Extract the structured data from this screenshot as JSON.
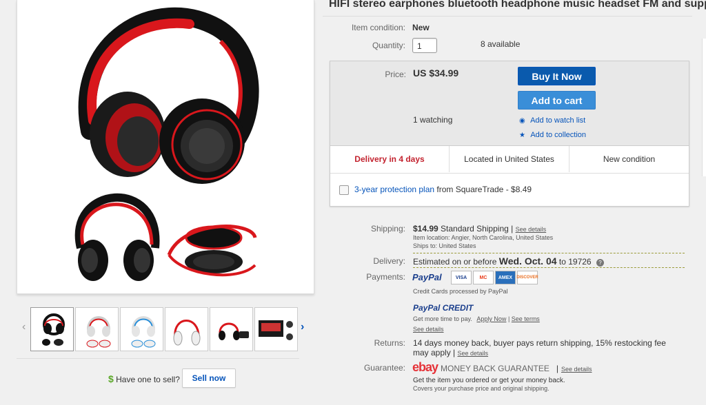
{
  "title": "HIFI stereo earphones bluetooth headphone music headset FM and support",
  "condition": {
    "label": "Item condition:",
    "value": "New"
  },
  "quantity": {
    "label": "Quantity:",
    "value": "1",
    "available": "8 available"
  },
  "price": {
    "label": "Price:",
    "value": "US $34.99"
  },
  "buttons": {
    "buy_now": "Buy It Now",
    "add_to_cart": "Add to cart"
  },
  "watching": "1 watching",
  "links": {
    "watch_list": "Add to watch list",
    "collection": "Add to collection"
  },
  "features": {
    "delivery": "Delivery in 4 days",
    "location": "Located in United States",
    "condition": "New condition"
  },
  "protection": {
    "link": "3-year protection plan",
    "rest": "from SquareTrade - $8.49"
  },
  "shipping": {
    "label": "Shipping:",
    "cost": "$14.99",
    "method": "Standard Shipping",
    "sep": "|",
    "see_details": "See details",
    "item_location": "Item location:  Angier, North Carolina, United States",
    "ships_to": "Ships to:  United States"
  },
  "delivery": {
    "label": "Delivery:",
    "prefix": "Estimated on or before",
    "date": "Wed. Oct. 04",
    "suffix": "to 19726",
    "help": "?"
  },
  "payments": {
    "label": "Payments:",
    "paypal": "PayPal",
    "cards": [
      "VISA",
      "MC",
      "AMEX",
      "DISCOVER"
    ],
    "processed": "Credit Cards processed by PayPal",
    "credit_logo": "PayPal CREDIT",
    "more_time": "Get more time to pay.",
    "apply_now": "Apply Now",
    "sep": "|",
    "see_terms": "See terms",
    "see_details": "See details"
  },
  "returns": {
    "label": "Returns:",
    "text": "14 days money back, buyer pays return shipping, 15% restocking fee may apply",
    "sep": "|",
    "see_details": "See details"
  },
  "guarantee": {
    "label": "Guarantee:",
    "ebay": "ebay",
    "mbg": "MONEY BACK GUARANTEE",
    "sep": "|",
    "see_details": "See details",
    "line1": "Get the item you ordered or get your money back.",
    "line2": "Covers your purchase price and original shipping."
  },
  "sell": {
    "question": "Have one to sell?",
    "button": "Sell now",
    "dollar": "$"
  },
  "gallery": {
    "prev": "‹",
    "next": "›"
  },
  "colors": {
    "link": "#0654ba",
    "delivery_red": "#c3232f",
    "buy_btn": "#0a5aad",
    "cart_btn": "#3a8ed8",
    "headphone_red": "#d9171c"
  }
}
